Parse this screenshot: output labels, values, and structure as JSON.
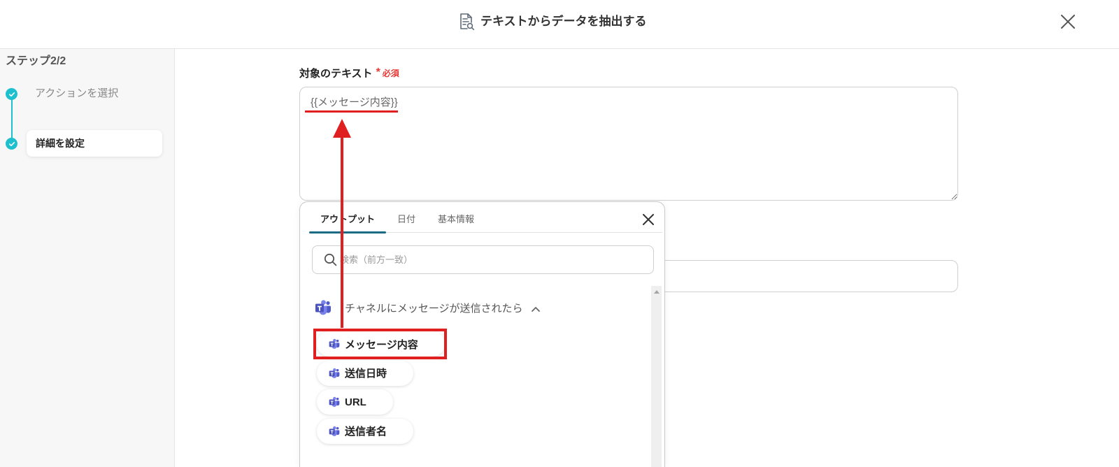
{
  "header": {
    "title": "テキストからデータを抽出する",
    "title_icon": "document-search-icon",
    "close_icon": "close-icon"
  },
  "sidebar": {
    "step_counter": "ステップ2/2",
    "steps": [
      {
        "label": "アクションを選択",
        "status": "completed",
        "active": false,
        "icon": "check-circle-icon"
      },
      {
        "label": "詳細を設定",
        "status": "completed",
        "active": true,
        "icon": "check-circle-icon"
      }
    ]
  },
  "form": {
    "target_text": {
      "label": "対象のテキスト",
      "required_mark": "*",
      "required_label": "必須",
      "value": "{{メッセージ内容}}"
    }
  },
  "output_picker": {
    "tabs": [
      {
        "label": "アウトプット",
        "active": true
      },
      {
        "label": "日付",
        "active": false
      },
      {
        "label": "基本情報",
        "active": false
      }
    ],
    "close_icon": "close-icon",
    "search": {
      "placeholder": "検索（前方一致）",
      "icon": "search-icon"
    },
    "group": {
      "label": "チャネルにメッセージが送信されたら",
      "icon": "microsoft-teams-icon",
      "expanded": true,
      "toggle_icon": "chevron-up-icon"
    },
    "items": [
      {
        "label": "メッセージ内容",
        "icon": "microsoft-teams-icon",
        "highlighted": true
      },
      {
        "label": "送信日時",
        "icon": "microsoft-teams-icon"
      },
      {
        "label": "URL",
        "icon": "microsoft-teams-icon"
      },
      {
        "label": "送信者名",
        "icon": "microsoft-teams-icon"
      }
    ]
  },
  "colors": {
    "accent": "#1ec0cf",
    "required": "#e53935",
    "annotation": "#e02020",
    "tab_indicator": "#1c6b84"
  }
}
